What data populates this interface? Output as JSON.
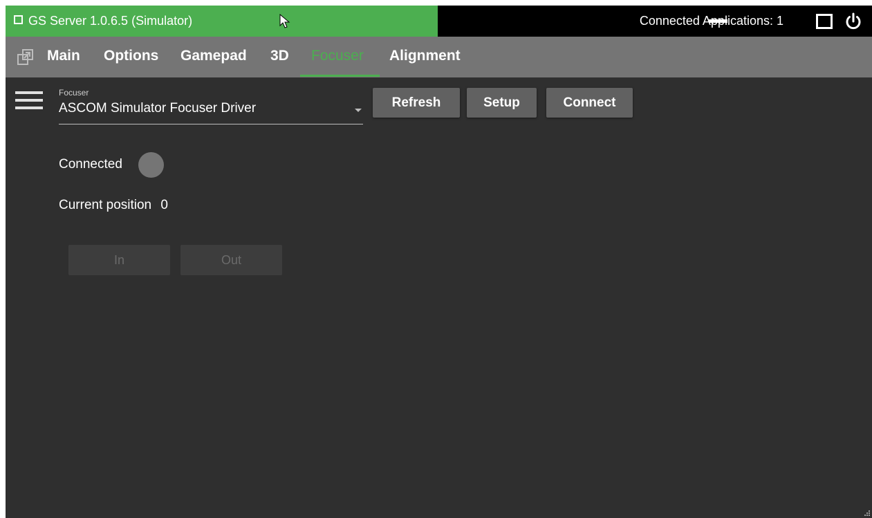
{
  "titlebar": {
    "app_title": "GS Server 1.0.6.5 (Simulator)",
    "connected_apps": "Connected Applications: 1",
    "accent_color": "#4caf50",
    "icons": [
      "app-icon",
      "minimize-icon",
      "maximize-icon",
      "power-icon"
    ]
  },
  "tabs": {
    "items": [
      {
        "label": "Main"
      },
      {
        "label": "Options"
      },
      {
        "label": "Gamepad"
      },
      {
        "label": "3D"
      },
      {
        "label": "Focuser"
      },
      {
        "label": "Alignment"
      }
    ],
    "active": "Focuser"
  },
  "focuser": {
    "select_label": "Focuser",
    "select_value": "ASCOM Simulator Focuser Driver",
    "refresh_label": "Refresh",
    "setup_label": "Setup",
    "connect_label": "Connect",
    "connected_label": "Connected",
    "connected_state": "off",
    "position_label": "Current position",
    "position_value": "0",
    "in_label": "In",
    "out_label": "Out"
  }
}
